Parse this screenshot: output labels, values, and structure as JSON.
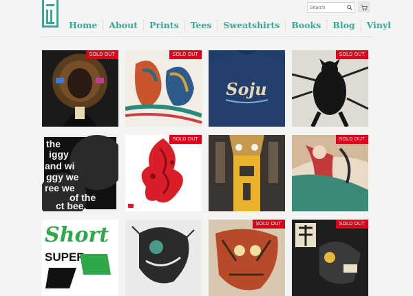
{
  "logo_text": "FIFTY",
  "header": {
    "search_placeholder": "Search",
    "search_icon": "search-icon",
    "cart_icon": "cart-icon"
  },
  "nav": {
    "items": [
      {
        "label": "Home"
      },
      {
        "label": "About"
      },
      {
        "label": "Prints"
      },
      {
        "label": "Tees"
      },
      {
        "label": "Sweatshirts"
      },
      {
        "label": "Books"
      },
      {
        "label": "Blog"
      },
      {
        "label": "Vinyl"
      }
    ]
  },
  "colors": {
    "accent": "#3aa79b",
    "sold_out": "#e0001b",
    "background": "#f4f4f2"
  },
  "products": [
    {
      "sold_out": true,
      "badge": "SOLD OUT"
    },
    {
      "sold_out": true,
      "badge": "SOLD OUT"
    },
    {
      "sold_out": false,
      "badge": ""
    },
    {
      "sold_out": true,
      "badge": "SOLD OUT"
    },
    {
      "sold_out": false,
      "badge": ""
    },
    {
      "sold_out": true,
      "badge": "SOLD OUT"
    },
    {
      "sold_out": false,
      "badge": ""
    },
    {
      "sold_out": true,
      "badge": "SOLD OUT"
    },
    {
      "sold_out": false,
      "badge": ""
    },
    {
      "sold_out": false,
      "badge": ""
    },
    {
      "sold_out": true,
      "badge": "SOLD OUT"
    },
    {
      "sold_out": true,
      "badge": "SOLD OUT"
    }
  ],
  "artwork_text": {
    "tee_word": "Soju",
    "poster_lines": [
      "the",
      "iggy",
      "and wi",
      "ggy we",
      "ree we",
      "of the",
      "ct bee."
    ],
    "green_word": "Short",
    "green_word2": "SUPER"
  }
}
